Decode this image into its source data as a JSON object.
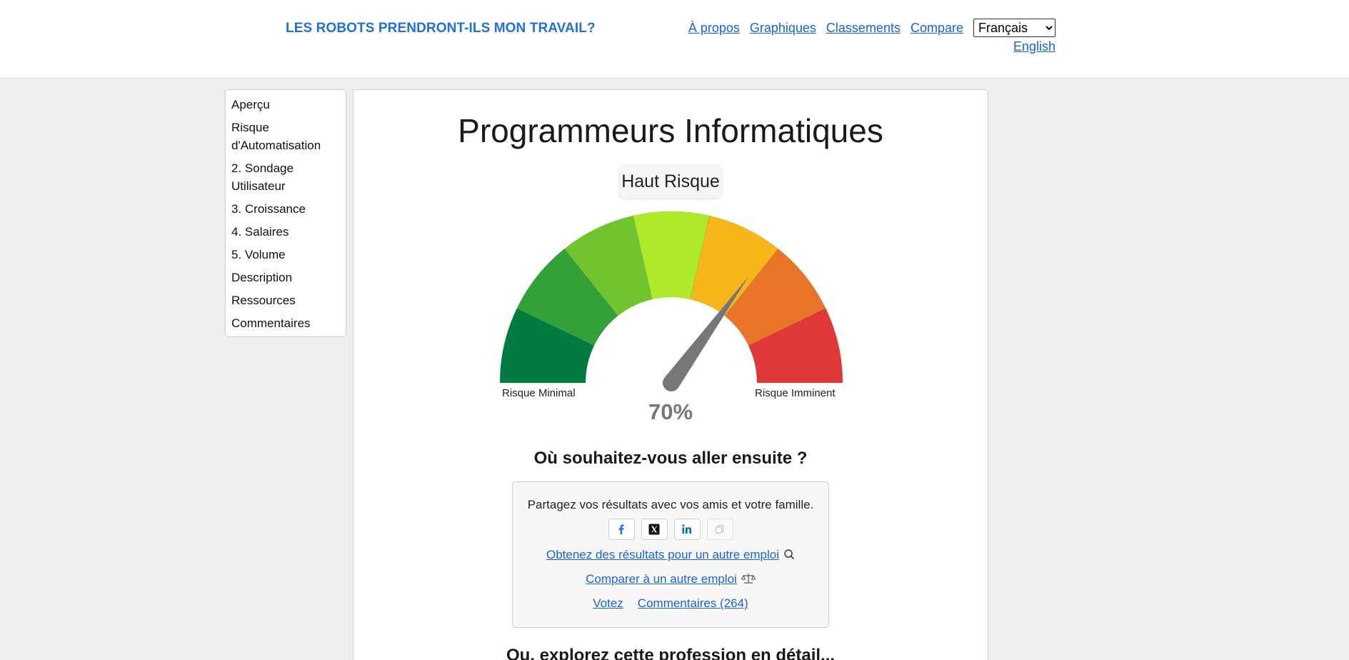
{
  "header": {
    "brand": "LES ROBOTS PRENDRONT-ILS MON TRAVAIL?",
    "nav": [
      "À propos",
      "Graphiques",
      "Classements",
      "Compare"
    ],
    "language_selected": "Français",
    "alt_language": "English"
  },
  "sidebar": {
    "items": [
      "Aperçu",
      "Risque d'Automatisation",
      "2. Sondage Utilisateur",
      "3. Croissance",
      "4. Salaires",
      "5. Volume",
      "Description",
      "Ressources",
      "Commentaires"
    ]
  },
  "main": {
    "title": "Programmeurs Informatiques",
    "risk_badge": "Haut Risque",
    "gauge": {
      "value_percent": 70,
      "value_text": "70%",
      "label_min": "Risque Minimal",
      "label_max": "Risque Imminent",
      "segment_colors": [
        "#007c3f",
        "#33a13a",
        "#70c52f",
        "#aeea2a",
        "#f5b719",
        "#e97528",
        "#e03838"
      ],
      "needle_color": "#777777"
    },
    "next_heading": "Où souhaitez-vous aller ensuite ?",
    "share": {
      "text": "Partagez vos résultats avec vos amis et votre famille.",
      "buttons": [
        "facebook-icon",
        "x-icon",
        "linkedin-icon",
        "copy-icon"
      ],
      "link_other_job": "Obtenez des résultats pour un autre emploi",
      "link_compare": "Comparer à un autre emploi",
      "link_vote": "Votez",
      "link_comments": "Commentaires (264)"
    },
    "explore_heading": "Ou, explorez cette profession en détail..."
  }
}
